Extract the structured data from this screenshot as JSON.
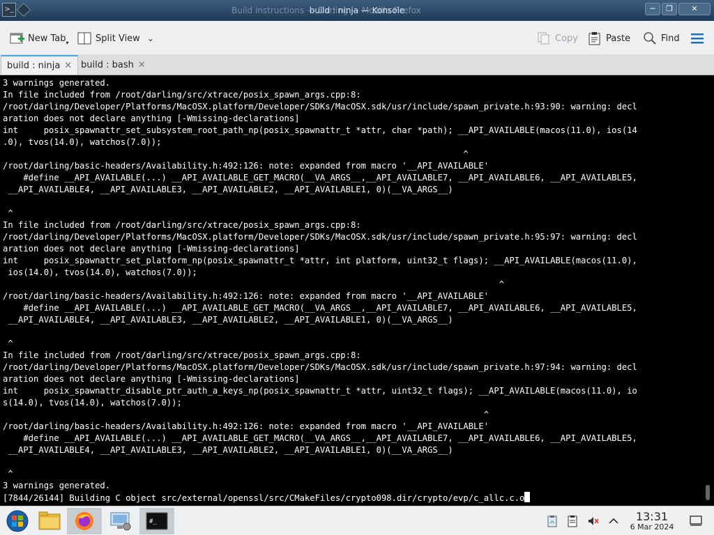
{
  "window": {
    "title": "build : ninja — Konsole",
    "background_title": "Build instructions — Darling — Mozilla Firefox"
  },
  "toolbar": {
    "new_tab_label": "New Tab",
    "split_view_label": "Split View",
    "copy_label": "Copy",
    "paste_label": "Paste",
    "find_label": "Find"
  },
  "tabs": [
    {
      "label": "build : ninja",
      "active": true
    },
    {
      "label": "build : bash",
      "active": false
    }
  ],
  "terminal": {
    "lines": [
      "3 warnings generated.",
      "In file included from /root/darling/src/xtrace/posix_spawn_args.cpp:8:",
      "/root/darling/Developer/Platforms/MacOSX.platform/Developer/SDKs/MacOSX.sdk/usr/include/spawn_private.h:93:90: warning: decl",
      "aration does not declare anything [-Wmissing-declarations]",
      "int     posix_spawnattr_set_subsystem_root_path_np(posix_spawnattr_t *attr, char *path); __API_AVAILABLE(macos(11.0), ios(14",
      ".0), tvos(14.0), watchos(7.0));",
      "                                                                                          ^",
      "/root/darling/basic-headers/Availability.h:492:126: note: expanded from macro '__API_AVAILABLE'",
      "    #define __API_AVAILABLE(...) __API_AVAILABLE_GET_MACRO(__VA_ARGS__,__API_AVAILABLE7, __API_AVAILABLE6, __API_AVAILABLE5,",
      " __API_AVAILABLE4, __API_AVAILABLE3, __API_AVAILABLE2, __API_AVAILABLE1, 0)(__VA_ARGS__)",
      "",
      " ^",
      "In file included from /root/darling/src/xtrace/posix_spawn_args.cpp:8:",
      "/root/darling/Developer/Platforms/MacOSX.platform/Developer/SDKs/MacOSX.sdk/usr/include/spawn_private.h:95:97: warning: decl",
      "aration does not declare anything [-Wmissing-declarations]",
      "int     posix_spawnattr_set_platform_np(posix_spawnattr_t *attr, int platform, uint32_t flags); __API_AVAILABLE(macos(11.0),",
      " ios(14.0), tvos(14.0), watchos(7.0));",
      "                                                                                                 ^",
      "/root/darling/basic-headers/Availability.h:492:126: note: expanded from macro '__API_AVAILABLE'",
      "    #define __API_AVAILABLE(...) __API_AVAILABLE_GET_MACRO(__VA_ARGS__,__API_AVAILABLE7, __API_AVAILABLE6, __API_AVAILABLE5,",
      " __API_AVAILABLE4, __API_AVAILABLE3, __API_AVAILABLE2, __API_AVAILABLE1, 0)(__VA_ARGS__)",
      "",
      " ^",
      "In file included from /root/darling/src/xtrace/posix_spawn_args.cpp:8:",
      "/root/darling/Developer/Platforms/MacOSX.platform/Developer/SDKs/MacOSX.sdk/usr/include/spawn_private.h:97:94: warning: decl",
      "aration does not declare anything [-Wmissing-declarations]",
      "int     posix_spawnattr_disable_ptr_auth_a_keys_np(posix_spawnattr_t *attr, uint32_t flags); __API_AVAILABLE(macos(11.0), io",
      "s(14.0), tvos(14.0), watchos(7.0));",
      "                                                                                              ^",
      "/root/darling/basic-headers/Availability.h:492:126: note: expanded from macro '__API_AVAILABLE'",
      "    #define __API_AVAILABLE(...) __API_AVAILABLE_GET_MACRO(__VA_ARGS__,__API_AVAILABLE7, __API_AVAILABLE6, __API_AVAILABLE5,",
      " __API_AVAILABLE4, __API_AVAILABLE3, __API_AVAILABLE2, __API_AVAILABLE1, 0)(__VA_ARGS__)",
      "",
      " ^",
      "3 warnings generated."
    ],
    "last_line": "[7844/26144] Building C object src/external/openssl/src/CMakeFiles/crypto098.dir/crypto/evp/c_allc.c.o"
  },
  "taskbar": {
    "apps": [
      {
        "icon": "start-menu-icon"
      },
      {
        "icon": "file-manager-icon"
      },
      {
        "icon": "firefox-icon"
      },
      {
        "icon": "system-settings-icon"
      },
      {
        "icon": "konsole-icon"
      }
    ],
    "clock_time": "13:31",
    "clock_date": "6 Mar 2024"
  },
  "colors": {
    "terminal_bg": "#000000",
    "terminal_fg": "#ffffff",
    "accent": "#3daee9",
    "titlebar": "#2a4a6b"
  }
}
